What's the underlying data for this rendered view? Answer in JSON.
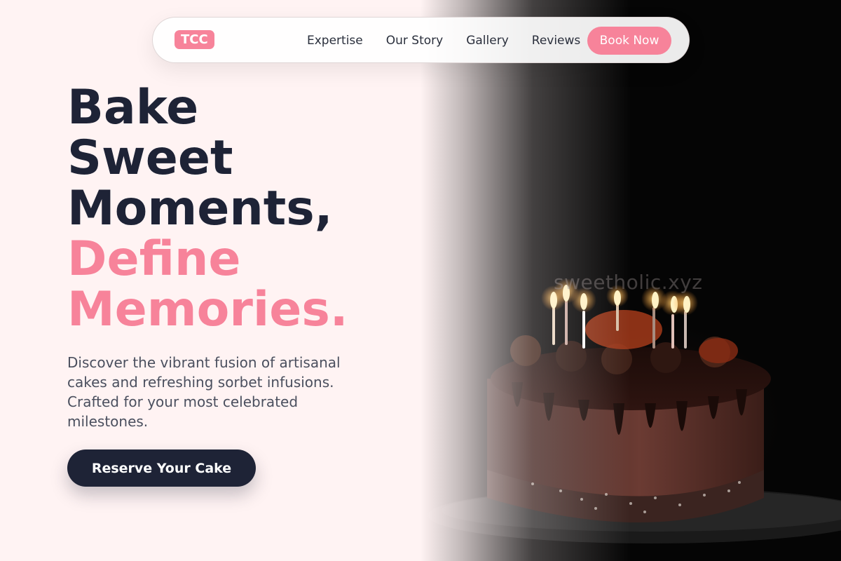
{
  "nav": {
    "logo": "TCC",
    "links": [
      {
        "label": "Expertise"
      },
      {
        "label": "Our Story"
      },
      {
        "label": "Gallery"
      },
      {
        "label": "Reviews"
      }
    ],
    "cta_label": "Book Now"
  },
  "hero": {
    "headline_line1": "Bake",
    "headline_line2": "Sweet",
    "headline_line3": "Moments,",
    "headline_accent1": "Define",
    "headline_accent2": "Memories.",
    "subtitle": "Discover the vibrant fusion of artisanal cakes and refreshing sorbet infusions. Crafted for your most celebrated milestones.",
    "cta_label": "Reserve Your Cake",
    "image_watermark": "sweetholic.xyz"
  },
  "colors": {
    "accent": "#f7839a",
    "dark": "#1e2336",
    "background": "#fff3f3"
  }
}
